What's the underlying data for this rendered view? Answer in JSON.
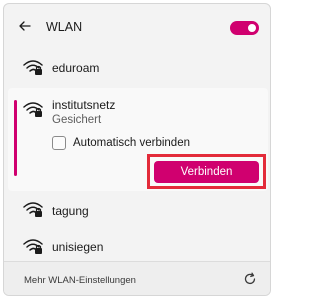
{
  "colors": {
    "accent": "#d0006f",
    "highlight": "#e32b3a"
  },
  "header": {
    "back_icon": "arrow-left-icon",
    "title": "WLAN",
    "toggle_state": "on"
  },
  "networks": [
    {
      "name": "eduroam",
      "secured": true
    },
    {
      "name": "institutsnetz",
      "secured": true,
      "status": "Gesichert",
      "expanded": true
    },
    {
      "name": "tagung",
      "secured": true
    },
    {
      "name": "unisiegen",
      "secured": true
    }
  ],
  "expanded_panel": {
    "auto_connect_label": "Automatisch verbinden",
    "auto_connect_checked": false,
    "connect_button_label": "Verbinden"
  },
  "footer": {
    "more_settings_label": "Mehr WLAN-Einstellungen",
    "refresh_icon": "refresh-icon"
  }
}
